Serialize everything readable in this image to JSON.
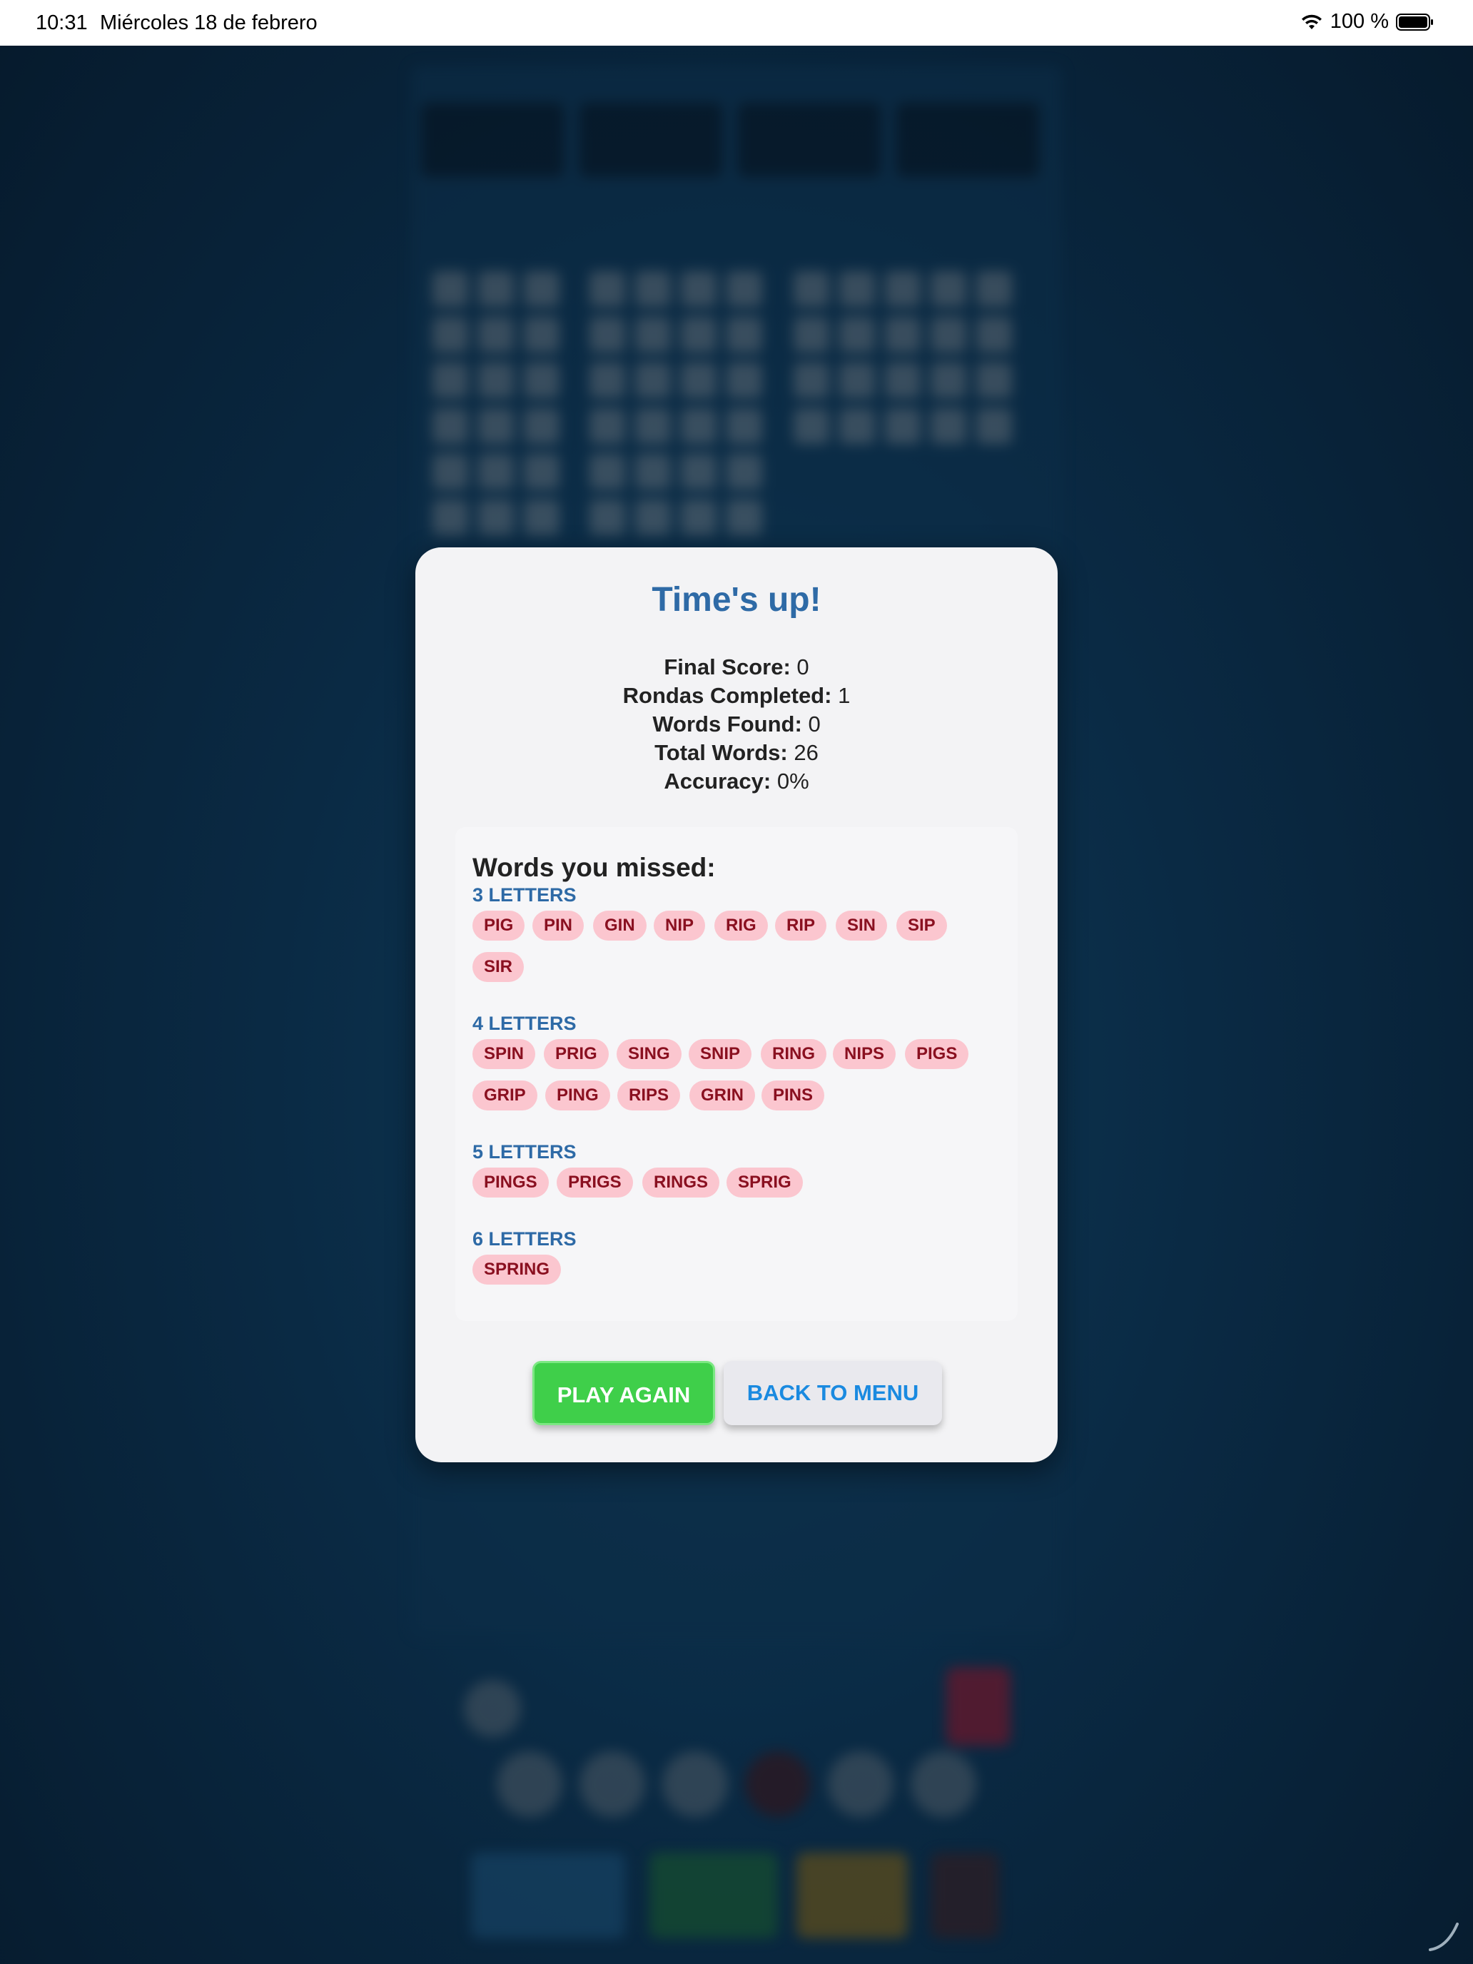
{
  "status_bar": {
    "time": "10:31",
    "date": "Miércoles 18 de febrero",
    "battery": "100 %"
  },
  "modal": {
    "title": "Time's up!",
    "stats": [
      {
        "label": "Final Score:",
        "value": "0"
      },
      {
        "label": "Rondas Completed:",
        "value": "1"
      },
      {
        "label": "Words Found:",
        "value": "0"
      },
      {
        "label": "Total Words:",
        "value": "26"
      },
      {
        "label": "Accuracy:",
        "value": "0%"
      }
    ],
    "missed_title": "Words you missed:",
    "groups": [
      {
        "label": "3 LETTERS",
        "words": [
          "PIG",
          "PIN",
          "GIN",
          "NIP",
          "RIG",
          "RIP",
          "SIN",
          "SIP",
          "SIR"
        ]
      },
      {
        "label": "4 LETTERS",
        "words": [
          "SPIN",
          "PRIG",
          "SING",
          "SNIP",
          "RING",
          "NIPS",
          "PIGS",
          "GRIP",
          "PING",
          "RIPS",
          "GRIN",
          "PINS"
        ]
      },
      {
        "label": "5 LETTERS",
        "words": [
          "PINGS",
          "PRIGS",
          "RINGS",
          "SPRIG"
        ]
      },
      {
        "label": "6 LETTERS",
        "words": [
          "SPRING"
        ]
      }
    ],
    "play_again": "PLAY AGAIN",
    "back_to_menu": "BACK TO MENU"
  },
  "colors": {
    "title": "#2e6aa6",
    "chip_bg": "#fbc6cf",
    "chip_text": "#8a1020",
    "play_bg": "#3fcf4a",
    "menu_text": "#1a8ae0"
  }
}
